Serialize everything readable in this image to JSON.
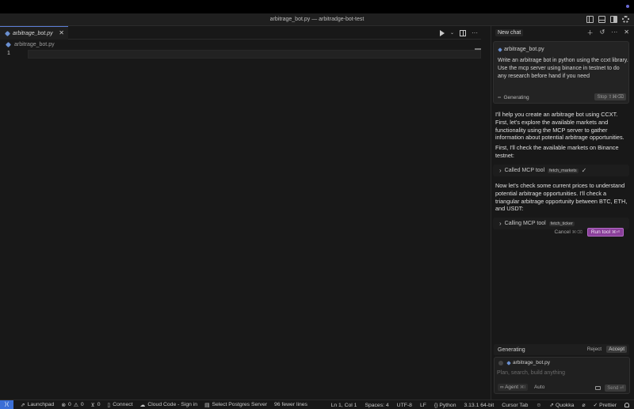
{
  "window": {
    "title": "arbitrage_bot.py — arbitradge-bot-test"
  },
  "editor": {
    "tab_label": "arbitrage_bot.py",
    "breadcrumb_file": "arbitrage_bot.py",
    "line_number": "1",
    "more": "···"
  },
  "chat": {
    "title": "New chat",
    "user_message": {
      "file": "arbitrage_bot.py",
      "line1": "Write an arbitrage bot in python using the ccxt library.",
      "line2": "Use the mcp server using binance in testnet to do any research before hand if you need",
      "status": "Generating",
      "stop_label": "Stop",
      "stop_shortcut": "⇧⌘⌫"
    },
    "assistant": {
      "para1": "I'll help you create an arbitrage bot using CCXT. First, let's explore the available markets and functionality using the MCP server to gather information about potential arbitrage opportunities.",
      "para2": "First, I'll check the available markets on Binance testnet:",
      "tool1_label": "Called MCP tool",
      "tool1_name": "fetch_markets",
      "para3": "Now let's check some current prices to understand potential arbitrage opportunities. I'll check a triangular arbitrage opportunity between BTC, ETH, and USDT:",
      "tool2_label": "Calling MCP tool",
      "tool2_name": "fetch_ticker",
      "cancel_label": "Cancel",
      "cancel_shortcut": "⌘⌫",
      "run_label": "Run tool",
      "run_shortcut": "⌘⏎"
    },
    "generating_bar": {
      "label": "Generating",
      "reject": "Reject",
      "accept": "Accept"
    },
    "composer": {
      "file": "arbitrage_bot.py",
      "placeholder": "Plan, search, build anything",
      "mode": "Agent",
      "mode_shortcut": "⌘I",
      "model": "Auto",
      "send": "Send",
      "send_shortcut": "⏎"
    }
  },
  "statusbar": {
    "launchpad": "Launchpad",
    "errors": "0",
    "warnings": "0",
    "ports": "0",
    "connect": "Connect",
    "cloud_code": "Cloud Code - Sign in",
    "postgres": "Select Postgres Server",
    "fewer_lines": "96 fewer lines",
    "position": "Ln 1, Col 1",
    "spaces": "Spaces: 4",
    "encoding": "UTF-8",
    "eol": "LF",
    "language": "Python",
    "interpreter": "3.13.1 64-bit",
    "cursor_tab": "Cursor Tab",
    "quokka": "Quokka",
    "prettier": "Prettier"
  },
  "colors": {
    "accent": "#3b6fd6",
    "run_button": "#8a3f9a",
    "background": "#181818"
  }
}
